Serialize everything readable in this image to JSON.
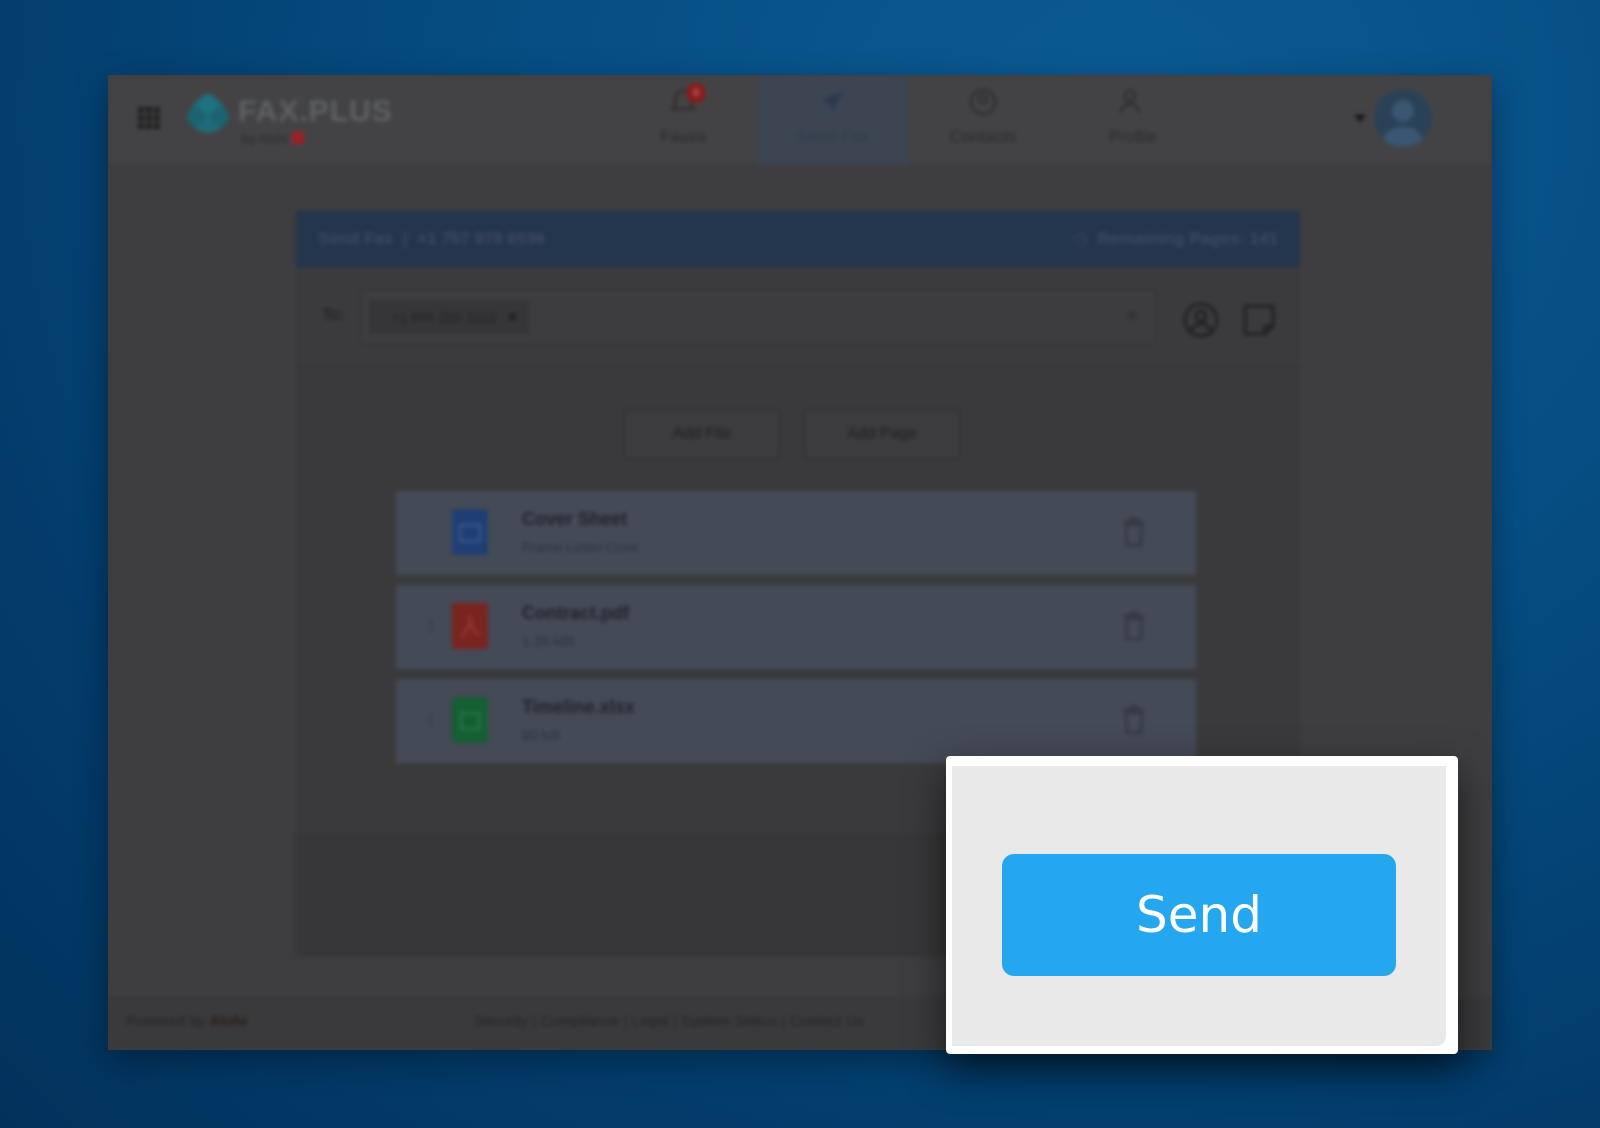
{
  "header": {
    "logo_text": "FAX.PLUS",
    "logo_sub": "by Alohi",
    "nav": [
      {
        "label": "Faxes",
        "icon": "bell-icon",
        "badge": "0"
      },
      {
        "label": "Send Fax",
        "icon": "paper-plane-icon"
      },
      {
        "label": "Contacts",
        "icon": "contact-icon"
      },
      {
        "label": "Profile",
        "icon": "profile-icon"
      }
    ]
  },
  "card": {
    "title": "Send Fax",
    "from_number": "+1 757 979 6536",
    "remaining_label": "Remaining Pages: 141",
    "to_label": "To:",
    "recipient": "+1 669 200 1010",
    "add_file_label": "Add File",
    "add_page_label": "Add Page",
    "files": [
      {
        "name": "Cover Sheet",
        "meta": "Frame Letter Cove",
        "icon": "document-icon",
        "color": "#2d5fae"
      },
      {
        "name": "Contract.pdf",
        "meta": "1.28 MB",
        "icon": "pdf-icon",
        "color": "#c4332b"
      },
      {
        "name": "Timeline.xlsx",
        "meta": "80 KB",
        "icon": "spreadsheet-icon",
        "color": "#1f9a4a"
      }
    ]
  },
  "footer": {
    "powered_prefix": "Powered by",
    "powered_brand": "Alohi",
    "links": "Security | Compliance | Legal | System Status | Contact Us"
  },
  "popup": {
    "send_label": "Send",
    "accent": "#24a7ef"
  }
}
